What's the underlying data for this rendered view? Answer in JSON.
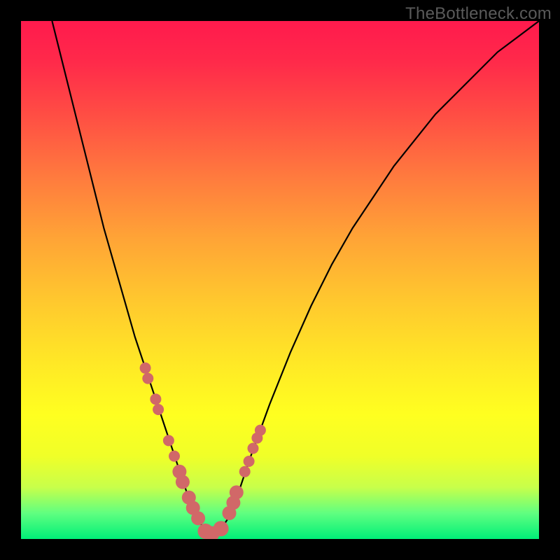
{
  "watermark": "TheBottleneck.com",
  "colors": {
    "curve": "#000000",
    "node_fill": "#d16868",
    "gradient_top": "#ff1a4d",
    "gradient_bottom": "#00ef78",
    "frame_border": "#000000"
  },
  "chart_data": {
    "type": "line",
    "title": "",
    "xlabel": "",
    "ylabel": "",
    "xlim": [
      0,
      100
    ],
    "ylim": [
      0,
      100
    ],
    "grid": false,
    "legend": false,
    "curve_min_x": 33,
    "series": [
      {
        "name": "bottleneck-curve",
        "x": [
          6,
          8,
          10,
          12,
          14,
          16,
          18,
          20,
          22,
          24,
          26,
          28,
          30,
          32,
          34,
          36,
          38,
          40,
          42,
          44,
          48,
          52,
          56,
          60,
          64,
          68,
          72,
          76,
          80,
          84,
          88,
          92,
          96,
          100
        ],
        "y": [
          100,
          92,
          84,
          76,
          68,
          60,
          53,
          46,
          39,
          33,
          27,
          21,
          15,
          9,
          4,
          1,
          1,
          4,
          9,
          15,
          26,
          36,
          45,
          53,
          60,
          66,
          72,
          77,
          82,
          86,
          90,
          94,
          97,
          100
        ]
      },
      {
        "name": "highlight-nodes",
        "x": [
          24,
          24.5,
          26,
          26.5,
          28.5,
          29.6,
          30.6,
          31.2,
          32.4,
          33.2,
          34.2,
          35.6,
          36.8,
          38.6,
          40.2,
          41,
          41.6,
          43.2,
          44,
          44.8,
          45.6,
          46.2
        ],
        "y": [
          33,
          31,
          27,
          25,
          19,
          16,
          13,
          11,
          8,
          6,
          4,
          1.5,
          1,
          2,
          5,
          7,
          9,
          13,
          15,
          17.5,
          19.5,
          21
        ],
        "r": [
          8,
          8,
          8,
          8,
          8,
          8,
          10,
          10,
          10,
          10,
          10,
          11,
          11,
          11,
          10,
          10,
          10,
          8,
          8,
          8,
          8,
          8
        ]
      }
    ]
  }
}
